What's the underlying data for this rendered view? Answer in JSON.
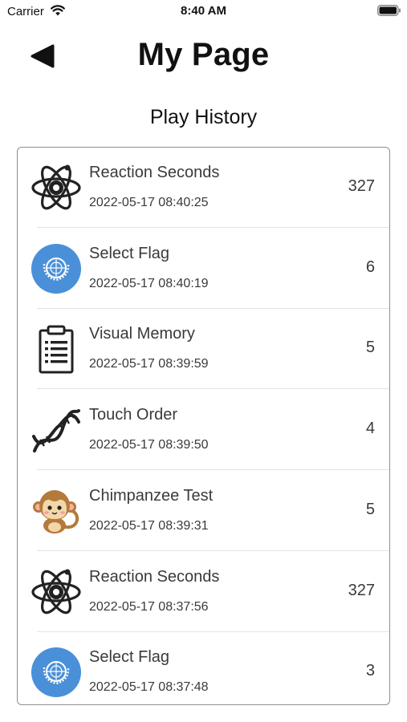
{
  "status_bar": {
    "carrier": "Carrier",
    "time": "8:40 AM"
  },
  "header": {
    "title": "My Page",
    "back_icon": "back-triangle-icon"
  },
  "section": {
    "title": "Play History"
  },
  "history": [
    {
      "game": "Reaction Seconds",
      "date": "2022-05-17 08:40:25",
      "score": "327",
      "icon": "atom-icon"
    },
    {
      "game": "Select Flag",
      "date": "2022-05-17 08:40:19",
      "score": "6",
      "icon": "un-flag-icon"
    },
    {
      "game": "Visual Memory",
      "date": "2022-05-17 08:39:59",
      "score": "5",
      "icon": "clipboard-icon"
    },
    {
      "game": "Touch Order",
      "date": "2022-05-17 08:39:50",
      "score": "4",
      "icon": "dna-icon"
    },
    {
      "game": "Chimpanzee Test",
      "date": "2022-05-17 08:39:31",
      "score": "5",
      "icon": "monkey-icon"
    },
    {
      "game": "Reaction Seconds",
      "date": "2022-05-17 08:37:56",
      "score": "327",
      "icon": "atom-icon"
    },
    {
      "game": "Select Flag",
      "date": "2022-05-17 08:37:48",
      "score": "3",
      "icon": "un-flag-icon"
    }
  ],
  "colors": {
    "flag_blue": "#4a90d9",
    "border": "#8e8e8e",
    "text": "#3a3a3a"
  }
}
